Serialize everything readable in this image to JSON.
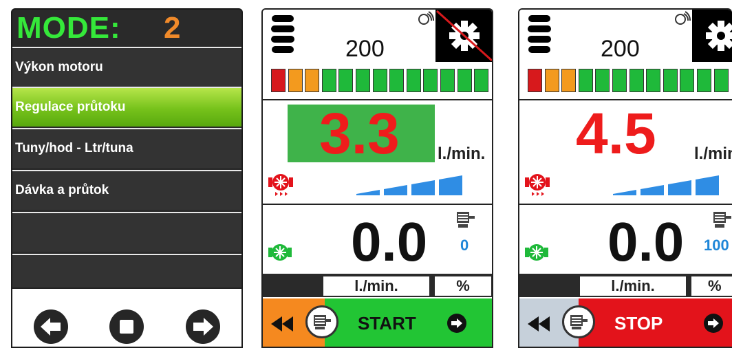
{
  "menu": {
    "mode_label": "MODE:",
    "mode_number": "2",
    "items": [
      {
        "label": "Výkon motoru"
      },
      {
        "label": "Regulace průtoku"
      },
      {
        "label": "Tuny/hod - Ltr/tuna"
      },
      {
        "label": "Dávka a průtok"
      },
      {
        "label": ""
      },
      {
        "label": ""
      }
    ],
    "active_index": 1,
    "footer_icons": [
      "arrow-left-icon",
      "stop-square-icon",
      "arrow-right-icon"
    ]
  },
  "screens": [
    {
      "tank_value": "200",
      "gear_disabled": true,
      "level_colors": [
        "#d7191c",
        "#f39a1e",
        "#f39a1e",
        "#1fb93a",
        "#1fb93a",
        "#1fb93a",
        "#1fb93a",
        "#1fb93a",
        "#1fb93a",
        "#1fb93a",
        "#1fb93a",
        "#1fb93a",
        "#1fb93a"
      ],
      "target_rate": "3.3",
      "target_highlighted": true,
      "rate_unit": "l./min.",
      "signal_bars": 4,
      "actual_flow": "0.0",
      "motor_value": "0",
      "flow_unit_label": "l./min.",
      "percent_label": "%",
      "action_label": "START",
      "action_color": "#22c534",
      "left_block_color": "#f5891f"
    },
    {
      "tank_value": "200",
      "gear_disabled": false,
      "level_colors": [
        "#d7191c",
        "#f39a1e",
        "#f39a1e",
        "#1fb93a",
        "#1fb93a",
        "#1fb93a",
        "#1fb93a",
        "#1fb93a",
        "#1fb93a",
        "#1fb93a",
        "#1fb93a",
        "#1fb93a"
      ],
      "target_rate": "4.5",
      "target_highlighted": false,
      "rate_unit": "l./min",
      "signal_bars": 4,
      "actual_flow": "0.0",
      "motor_value": "100",
      "flow_unit_label": "l./min.",
      "percent_label": "%",
      "action_label": "STOP",
      "action_color": "#e3131b",
      "left_block_color": "#c6d0da"
    }
  ]
}
